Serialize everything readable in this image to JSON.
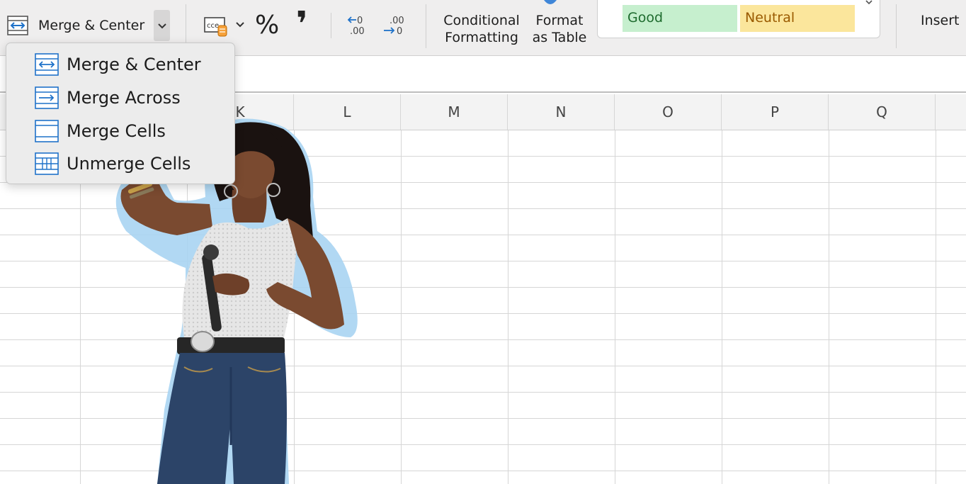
{
  "ribbon": {
    "merge_label": "Merge & Center",
    "percent_symbol": "%",
    "comma_symbol": "❜",
    "conditional_line1": "Conditional",
    "conditional_line2": "Formatting",
    "format_line1": "Format",
    "format_line2": "as Table",
    "style_good": "Good",
    "style_neutral": "Neutral",
    "insert_label": "Insert"
  },
  "merge_menu": {
    "items": [
      {
        "label": "Merge & Center",
        "icon": "merge-center-icon"
      },
      {
        "label": "Merge Across",
        "icon": "merge-across-icon"
      },
      {
        "label": "Merge Cells",
        "icon": "merge-cells-icon"
      },
      {
        "label": "Unmerge Cells",
        "icon": "unmerge-cells-icon"
      }
    ]
  },
  "columns": [
    "K",
    "L",
    "M",
    "N",
    "O",
    "P",
    "Q"
  ],
  "colors": {
    "accent_blue": "#1f72c9",
    "good_fill": "#c6efce",
    "good_text": "#1e6b2e",
    "neutral_fill": "#fbe69c",
    "neutral_text": "#9a5a00"
  }
}
